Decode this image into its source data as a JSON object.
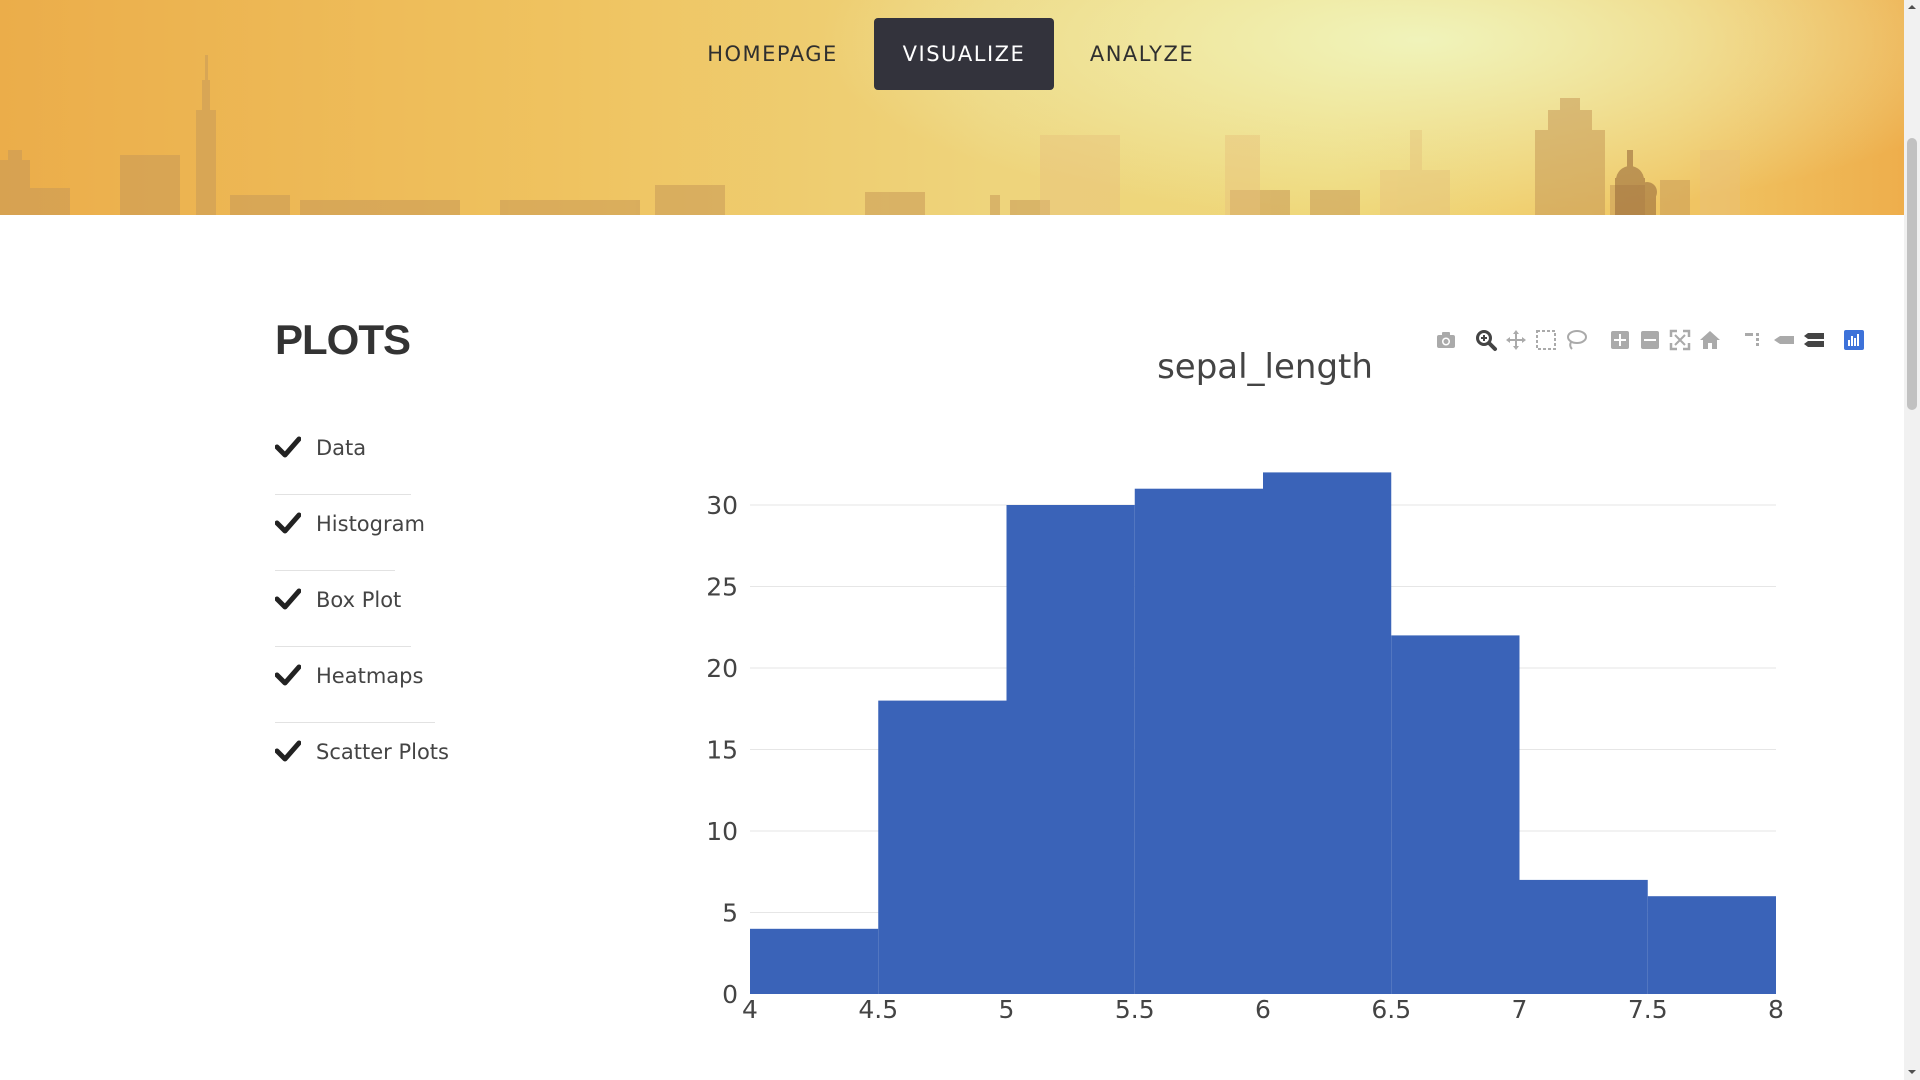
{
  "nav": {
    "items": [
      {
        "label": "HOMEPAGE",
        "active": false
      },
      {
        "label": "VISUALIZE",
        "active": true
      },
      {
        "label": "ANALYZE",
        "active": false
      }
    ]
  },
  "sidebar": {
    "title": "PLOTS",
    "items": [
      {
        "label": "Data",
        "icon": "check-icon"
      },
      {
        "label": "Histogram",
        "icon": "check-icon"
      },
      {
        "label": "Box Plot",
        "icon": "check-icon"
      },
      {
        "label": "Heatmaps",
        "icon": "check-icon"
      },
      {
        "label": "Scatter Plots",
        "icon": "check-icon"
      }
    ]
  },
  "modebar": {
    "icons": [
      "camera-icon",
      "zoom-icon",
      "pan-icon",
      "box-select-icon",
      "lasso-select-icon",
      "zoom-in-icon",
      "zoom-out-icon",
      "autoscale-icon",
      "reset-axes-icon",
      "spike-lines-icon",
      "hover-closest-icon",
      "hover-compare-icon",
      "plotly-logo-icon"
    ]
  },
  "colors": {
    "bar": "#3a63b8",
    "nav_active_bg": "#33333c",
    "grid": "#e6e6e6",
    "text": "#444444"
  },
  "chart_data": {
    "type": "bar",
    "title": "sepal_length",
    "xlabel": "",
    "ylabel": "",
    "bins": [
      {
        "x0": 4.0,
        "x1": 4.5,
        "count": 4
      },
      {
        "x0": 4.5,
        "x1": 5.0,
        "count": 18
      },
      {
        "x0": 5.0,
        "x1": 5.5,
        "count": 30
      },
      {
        "x0": 5.5,
        "x1": 6.0,
        "count": 31
      },
      {
        "x0": 6.0,
        "x1": 6.5,
        "count": 32
      },
      {
        "x0": 6.5,
        "x1": 7.0,
        "count": 22
      },
      {
        "x0": 7.0,
        "x1": 7.5,
        "count": 7
      },
      {
        "x0": 7.5,
        "x1": 8.0,
        "count": 6
      }
    ],
    "x_ticks": [
      "4",
      "4.5",
      "5",
      "5.5",
      "6",
      "6.5",
      "7",
      "7.5",
      "8"
    ],
    "y_ticks": [
      "0",
      "5",
      "10",
      "15",
      "20",
      "25",
      "30"
    ],
    "xlim": [
      4,
      8
    ],
    "ylim": [
      0,
      32
    ],
    "grid": true
  }
}
